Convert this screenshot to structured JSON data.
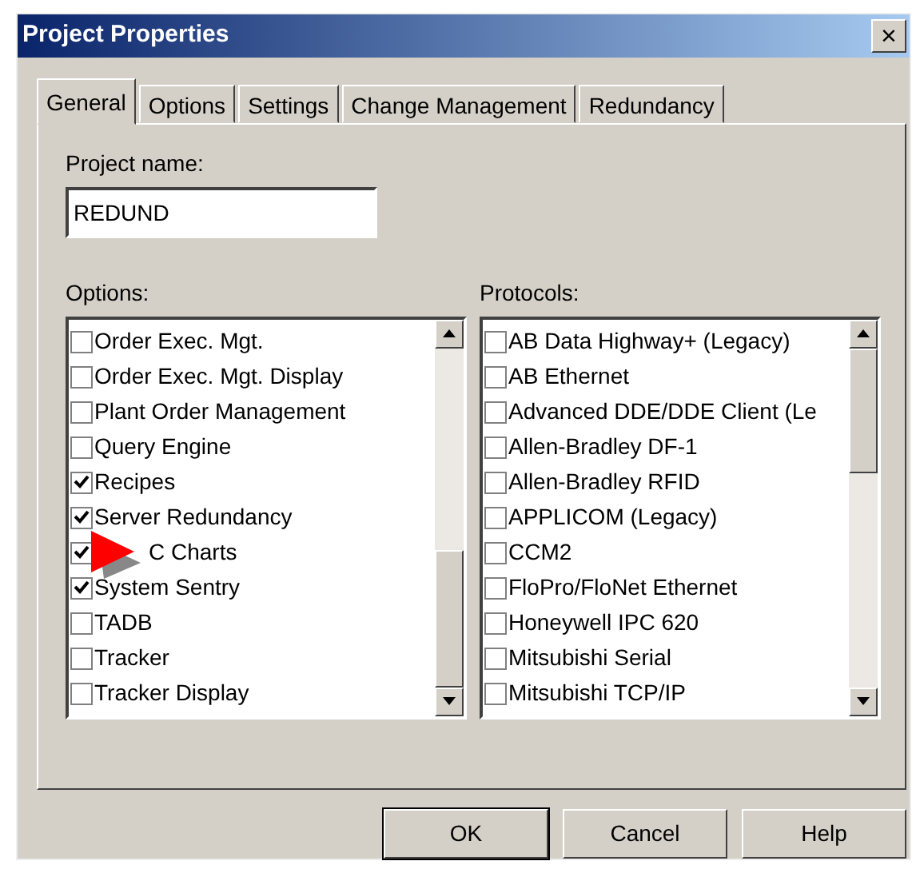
{
  "window": {
    "title": "Project Properties",
    "close": "×"
  },
  "tabs": [
    {
      "label": "General",
      "selected": true
    },
    {
      "label": "Options",
      "selected": false
    },
    {
      "label": "Settings",
      "selected": false
    },
    {
      "label": "Change Management",
      "selected": false
    },
    {
      "label": "Redundancy",
      "selected": false
    }
  ],
  "project_name": {
    "label": "Project name:",
    "value": "REDUND"
  },
  "options": {
    "label": "Options:",
    "items": [
      {
        "label": "Order Exec. Mgt.",
        "checked": false
      },
      {
        "label": "Order Exec. Mgt. Display",
        "checked": false
      },
      {
        "label": "Plant Order Management",
        "checked": false
      },
      {
        "label": "Query Engine",
        "checked": false
      },
      {
        "label": "Recipes",
        "checked": true
      },
      {
        "label": "Server Redundancy",
        "checked": true
      },
      {
        "label": "C Charts",
        "checked": true,
        "pointer": true
      },
      {
        "label": "System Sentry",
        "checked": true
      },
      {
        "label": "TADB",
        "checked": false
      },
      {
        "label": "Tracker",
        "checked": false
      },
      {
        "label": "Tracker Display",
        "checked": false
      }
    ]
  },
  "protocols": {
    "label": "Protocols:",
    "items": [
      {
        "label": "AB Data Highway+ (Legacy)",
        "checked": false
      },
      {
        "label": "AB Ethernet",
        "checked": false
      },
      {
        "label": "Advanced DDE/DDE Client (Le",
        "checked": false
      },
      {
        "label": "Allen-Bradley DF-1",
        "checked": false
      },
      {
        "label": "Allen-Bradley RFID",
        "checked": false
      },
      {
        "label": "APPLICOM (Legacy)",
        "checked": false
      },
      {
        "label": "CCM2",
        "checked": false
      },
      {
        "label": "FloPro/FloNet Ethernet",
        "checked": false
      },
      {
        "label": "Honeywell IPC 620",
        "checked": false
      },
      {
        "label": "Mitsubishi Serial",
        "checked": false
      },
      {
        "label": "Mitsubishi TCP/IP",
        "checked": false
      }
    ]
  },
  "buttons": [
    {
      "label": "OK",
      "default": true
    },
    {
      "label": "Cancel",
      "default": false
    },
    {
      "label": "Help",
      "default": false
    }
  ]
}
